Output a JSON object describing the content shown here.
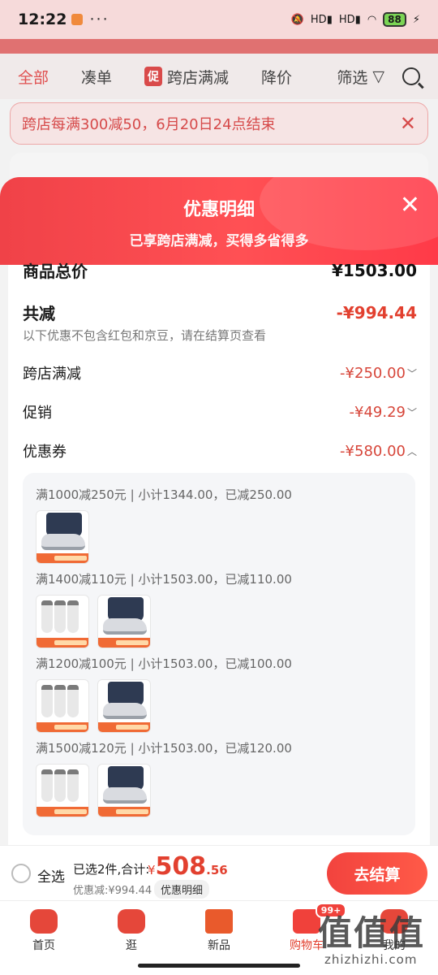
{
  "status": {
    "time": "12:22",
    "signal1": "HD",
    "signal2": "HD",
    "battery": "88"
  },
  "tabs": [
    "全部",
    "凑单",
    "跨店满减",
    "降价",
    "筛选"
  ],
  "promo_badge": "促",
  "notice": {
    "text": "跨店每满300减50，6月20日24点结束"
  },
  "sheet": {
    "title": "优惠明细",
    "subtitle": "已享跨店满减，买得多省得多",
    "total_label": "商品总价",
    "total_value": "¥1503.00",
    "saved_label": "共减",
    "saved_value": "-¥994.44",
    "note": "以下优惠不包含红包和京豆，请在结算页查看",
    "items": [
      {
        "label": "跨店满减",
        "value": "-¥250.00",
        "chevron": "chevron-down"
      },
      {
        "label": "促销",
        "value": "-¥49.29",
        "chevron": "chevron-down"
      },
      {
        "label": "优惠券",
        "value": "-¥580.00",
        "chevron": "chevron-up"
      }
    ],
    "coupon_groups": [
      {
        "title": "满1000减250元 | 小计1344.00，已减250.00",
        "products": [
          "shoe"
        ]
      },
      {
        "title": "满1400减110元 | 小计1503.00，已减110.00",
        "products": [
          "socks",
          "shoe"
        ]
      },
      {
        "title": "满1200减100元 | 小计1503.00，已减100.00",
        "products": [
          "socks",
          "shoe"
        ]
      },
      {
        "title": "满1500减120元 | 小计1503.00，已减120.00",
        "products": [
          "socks",
          "shoe"
        ]
      }
    ]
  },
  "checkout": {
    "select_all": "全选",
    "selected": "已选2件,合计:",
    "yen": "¥",
    "price_int": "508",
    "price_dec": ".56",
    "discount": "优惠减:¥994.44",
    "detail_button": "优惠明细",
    "checkout_button": "去结算"
  },
  "tabbar": [
    {
      "label": "首页"
    },
    {
      "label": "逛"
    },
    {
      "label": "新品"
    },
    {
      "label": "购物车",
      "badge": "99+"
    },
    {
      "label": "我的"
    }
  ],
  "watermark": {
    "main": "值值值",
    "sub": "zhizhizhi.com"
  },
  "colors": {
    "accent": "#e2402f",
    "sheet_gradient_start": "#f04248",
    "checkout_button": "#f2433e"
  }
}
